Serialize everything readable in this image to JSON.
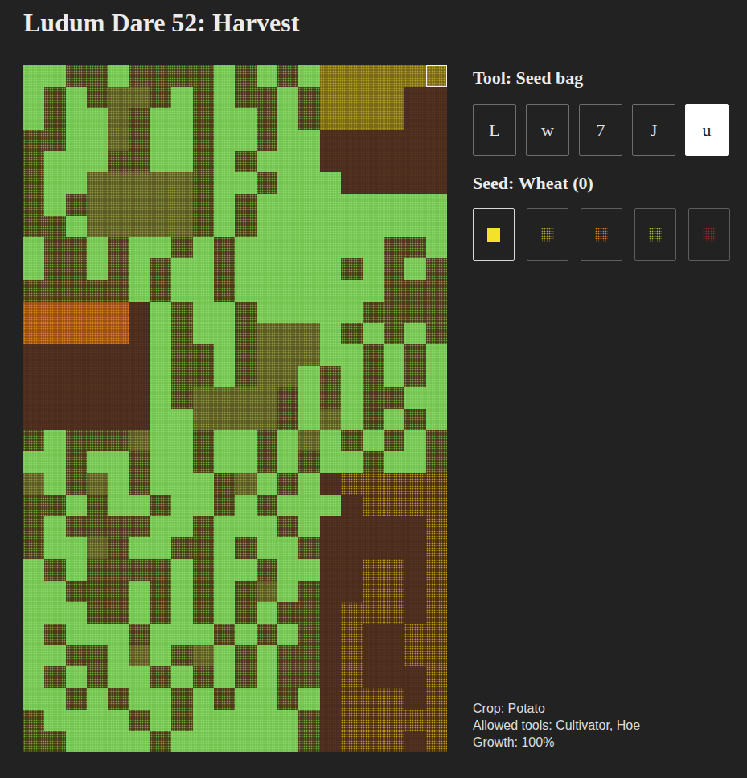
{
  "title": "Ludum Dare 52: Harvest",
  "tool_label": "Tool: Seed bag",
  "tools": [
    {
      "label": "L",
      "selected": false
    },
    {
      "label": "w",
      "selected": false
    },
    {
      "label": "7",
      "selected": false
    },
    {
      "label": "J",
      "selected": false
    },
    {
      "label": "u",
      "selected": true
    }
  ],
  "seed_label": "Seed: Wheat (0)",
  "seeds": [
    {
      "kind": "solid",
      "color": "#f2e22a",
      "selected": true
    },
    {
      "kind": "dotted",
      "color": "#b8a82a",
      "selected": false
    },
    {
      "kind": "dotted",
      "color": "#e07a1e",
      "selected": false
    },
    {
      "kind": "dotted",
      "color": "#a8b83a",
      "selected": false
    },
    {
      "kind": "dotted",
      "color": "#8a2e22",
      "selected": false
    }
  ],
  "tile_kinds": [
    {
      "code": "g",
      "kind": "grass",
      "color": "#74c452",
      "dots": "#8fd86c"
    },
    {
      "code": "d",
      "kind": "weedy-soil",
      "color": "#4e3a1a",
      "dots": "#6fa640"
    },
    {
      "code": "m",
      "kind": "tilled",
      "color": "#5e5a26",
      "dots": "#8a9a3e"
    },
    {
      "code": "y",
      "kind": "wheat",
      "color": "#7a6a18",
      "dots": "#b4a022"
    },
    {
      "code": "b",
      "kind": "bare-soil",
      "color": "#4a2c1c",
      "dots": "#5a3422"
    },
    {
      "code": "o",
      "kind": "carrot",
      "color": "#9a5018",
      "dots": "#e0801e"
    },
    {
      "code": "w",
      "kind": "ripening",
      "color": "#4e3018",
      "dots": "#c09a1a"
    }
  ],
  "field": {
    "rows": [
      "ggddgddddgdgdgyyyyyy",
      "gdgdmmdgdgddgdyyyybb",
      "gdggmdggdggdgdyyyybb",
      "ddggmdggdggdggbbbbbb",
      "dgggddggdgdgggbbbbbb",
      "dggmmmmmdggdgggbbbbb",
      "dgdmmmmmdgdggggggggg",
      "ddgmmmmmdgdggggggggg",
      "gddgdggdgdgggggggddg",
      "gddgdgdggdgggggdgdgd",
      "dddddgdggdgggggggddd",
      "ooooobgdggdgggggdddd",
      "ooooobgdggdmmmgdgdgd",
      "bbbbbbgddgdmmmggdgdg",
      "bbbbbbgddgdmmgdgdgdg",
      "bbbbbbgdmmmmdgdgddgg",
      "bbbbbbggmmmmdgmgdgdg",
      "dgdddmggdggdgmgdgdgd",
      "ggdggdggdggdgdggdggd",
      "mgdmgdgggdmgdgbwwwww",
      "ddgdggdggdgdgggbwwww",
      "dgddddggdgggdgbbbbbw",
      "dggmdggddgdggdbbbbbw",
      "gdgddddgdggdggbbwwbw",
      "ggdddgdgdgdmgdbbwwbw",
      "gggddgdgdgdgddbwwwbw",
      "gdgggdgggdgdgdbwbbww",
      "ggddgmgdmgdgddbwbbww",
      "gdgdggdgdgdgddbwbbbw",
      "ggdgdggdgdggdgbwwwbw",
      "dggggdgdgggggdbwwwww",
      "ddggggdggggggdbwwwbw"
    ]
  },
  "selected_tile": {
    "row": 0,
    "col": 19
  },
  "info": [
    "Crop: Potato",
    "Allowed tools: Cultivator, Hoe",
    "Growth: 100%"
  ]
}
